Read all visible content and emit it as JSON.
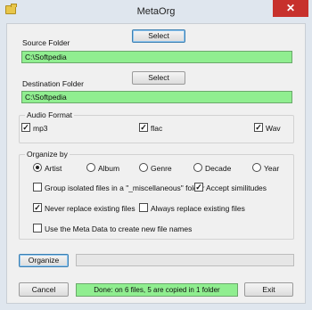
{
  "window": {
    "title": "MetaOrg",
    "close_glyph": "✕",
    "app_icon": "folder-icon"
  },
  "source": {
    "label": "Source Folder",
    "button": "Select",
    "path": "C:\\Softpedia"
  },
  "destination": {
    "label": "Destination Folder",
    "button": "Select",
    "path": "C:\\Softpedia"
  },
  "audio_format": {
    "title": "Audio Format",
    "options": [
      {
        "label": "mp3",
        "checked": true
      },
      {
        "label": "flac",
        "checked": true
      },
      {
        "label": "Wav",
        "checked": true
      }
    ]
  },
  "organize_by": {
    "title": "Organize by",
    "radios": [
      {
        "label": "Artist",
        "selected": true
      },
      {
        "label": "Album",
        "selected": false
      },
      {
        "label": "Genre",
        "selected": false
      },
      {
        "label": "Decade",
        "selected": false
      },
      {
        "label": "Year",
        "selected": false
      }
    ],
    "group_misc": {
      "label": "Group isolated files in a \"_miscellaneous\" folder",
      "checked": false
    },
    "accept_sim": {
      "label": "Accept similitudes",
      "checked": true
    },
    "never_replace": {
      "label": "Never replace existing files",
      "checked": true
    },
    "always_replace": {
      "label": "Always replace existing files",
      "checked": false
    },
    "use_meta": {
      "label": "Use the Meta Data to create new file names",
      "checked": false
    }
  },
  "organize_button": "Organize",
  "progress": 0,
  "cancel_button": "Cancel",
  "status": "Done: on 6 files, 5 are copied in 1 folder",
  "exit_button": "Exit",
  "colors": {
    "path_bg": "#90ee90",
    "close_red": "#c7312c",
    "frame": "#dfe6ee"
  }
}
